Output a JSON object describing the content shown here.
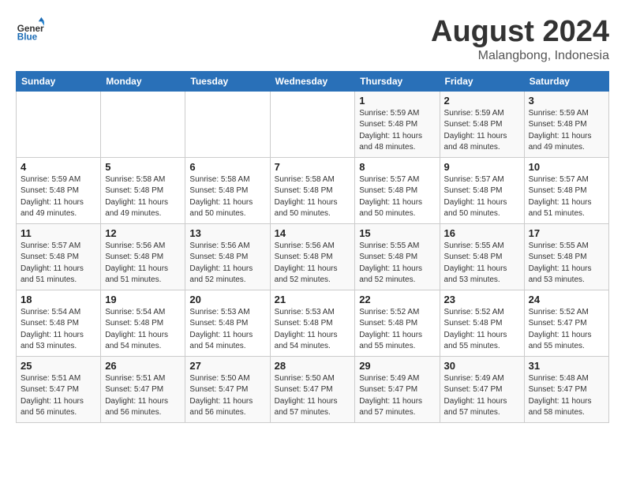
{
  "header": {
    "logo_general": "General",
    "logo_blue": "Blue",
    "month_title": "August 2024",
    "location": "Malangbong, Indonesia"
  },
  "days_of_week": [
    "Sunday",
    "Monday",
    "Tuesday",
    "Wednesday",
    "Thursday",
    "Friday",
    "Saturday"
  ],
  "weeks": [
    [
      {
        "day": "",
        "detail": ""
      },
      {
        "day": "",
        "detail": ""
      },
      {
        "day": "",
        "detail": ""
      },
      {
        "day": "",
        "detail": ""
      },
      {
        "day": "1",
        "detail": "Sunrise: 5:59 AM\nSunset: 5:48 PM\nDaylight: 11 hours\nand 48 minutes."
      },
      {
        "day": "2",
        "detail": "Sunrise: 5:59 AM\nSunset: 5:48 PM\nDaylight: 11 hours\nand 48 minutes."
      },
      {
        "day": "3",
        "detail": "Sunrise: 5:59 AM\nSunset: 5:48 PM\nDaylight: 11 hours\nand 49 minutes."
      }
    ],
    [
      {
        "day": "4",
        "detail": "Sunrise: 5:59 AM\nSunset: 5:48 PM\nDaylight: 11 hours\nand 49 minutes."
      },
      {
        "day": "5",
        "detail": "Sunrise: 5:58 AM\nSunset: 5:48 PM\nDaylight: 11 hours\nand 49 minutes."
      },
      {
        "day": "6",
        "detail": "Sunrise: 5:58 AM\nSunset: 5:48 PM\nDaylight: 11 hours\nand 50 minutes."
      },
      {
        "day": "7",
        "detail": "Sunrise: 5:58 AM\nSunset: 5:48 PM\nDaylight: 11 hours\nand 50 minutes."
      },
      {
        "day": "8",
        "detail": "Sunrise: 5:57 AM\nSunset: 5:48 PM\nDaylight: 11 hours\nand 50 minutes."
      },
      {
        "day": "9",
        "detail": "Sunrise: 5:57 AM\nSunset: 5:48 PM\nDaylight: 11 hours\nand 50 minutes."
      },
      {
        "day": "10",
        "detail": "Sunrise: 5:57 AM\nSunset: 5:48 PM\nDaylight: 11 hours\nand 51 minutes."
      }
    ],
    [
      {
        "day": "11",
        "detail": "Sunrise: 5:57 AM\nSunset: 5:48 PM\nDaylight: 11 hours\nand 51 minutes."
      },
      {
        "day": "12",
        "detail": "Sunrise: 5:56 AM\nSunset: 5:48 PM\nDaylight: 11 hours\nand 51 minutes."
      },
      {
        "day": "13",
        "detail": "Sunrise: 5:56 AM\nSunset: 5:48 PM\nDaylight: 11 hours\nand 52 minutes."
      },
      {
        "day": "14",
        "detail": "Sunrise: 5:56 AM\nSunset: 5:48 PM\nDaylight: 11 hours\nand 52 minutes."
      },
      {
        "day": "15",
        "detail": "Sunrise: 5:55 AM\nSunset: 5:48 PM\nDaylight: 11 hours\nand 52 minutes."
      },
      {
        "day": "16",
        "detail": "Sunrise: 5:55 AM\nSunset: 5:48 PM\nDaylight: 11 hours\nand 53 minutes."
      },
      {
        "day": "17",
        "detail": "Sunrise: 5:55 AM\nSunset: 5:48 PM\nDaylight: 11 hours\nand 53 minutes."
      }
    ],
    [
      {
        "day": "18",
        "detail": "Sunrise: 5:54 AM\nSunset: 5:48 PM\nDaylight: 11 hours\nand 53 minutes."
      },
      {
        "day": "19",
        "detail": "Sunrise: 5:54 AM\nSunset: 5:48 PM\nDaylight: 11 hours\nand 54 minutes."
      },
      {
        "day": "20",
        "detail": "Sunrise: 5:53 AM\nSunset: 5:48 PM\nDaylight: 11 hours\nand 54 minutes."
      },
      {
        "day": "21",
        "detail": "Sunrise: 5:53 AM\nSunset: 5:48 PM\nDaylight: 11 hours\nand 54 minutes."
      },
      {
        "day": "22",
        "detail": "Sunrise: 5:52 AM\nSunset: 5:48 PM\nDaylight: 11 hours\nand 55 minutes."
      },
      {
        "day": "23",
        "detail": "Sunrise: 5:52 AM\nSunset: 5:48 PM\nDaylight: 11 hours\nand 55 minutes."
      },
      {
        "day": "24",
        "detail": "Sunrise: 5:52 AM\nSunset: 5:47 PM\nDaylight: 11 hours\nand 55 minutes."
      }
    ],
    [
      {
        "day": "25",
        "detail": "Sunrise: 5:51 AM\nSunset: 5:47 PM\nDaylight: 11 hours\nand 56 minutes."
      },
      {
        "day": "26",
        "detail": "Sunrise: 5:51 AM\nSunset: 5:47 PM\nDaylight: 11 hours\nand 56 minutes."
      },
      {
        "day": "27",
        "detail": "Sunrise: 5:50 AM\nSunset: 5:47 PM\nDaylight: 11 hours\nand 56 minutes."
      },
      {
        "day": "28",
        "detail": "Sunrise: 5:50 AM\nSunset: 5:47 PM\nDaylight: 11 hours\nand 57 minutes."
      },
      {
        "day": "29",
        "detail": "Sunrise: 5:49 AM\nSunset: 5:47 PM\nDaylight: 11 hours\nand 57 minutes."
      },
      {
        "day": "30",
        "detail": "Sunrise: 5:49 AM\nSunset: 5:47 PM\nDaylight: 11 hours\nand 57 minutes."
      },
      {
        "day": "31",
        "detail": "Sunrise: 5:48 AM\nSunset: 5:47 PM\nDaylight: 11 hours\nand 58 minutes."
      }
    ]
  ]
}
